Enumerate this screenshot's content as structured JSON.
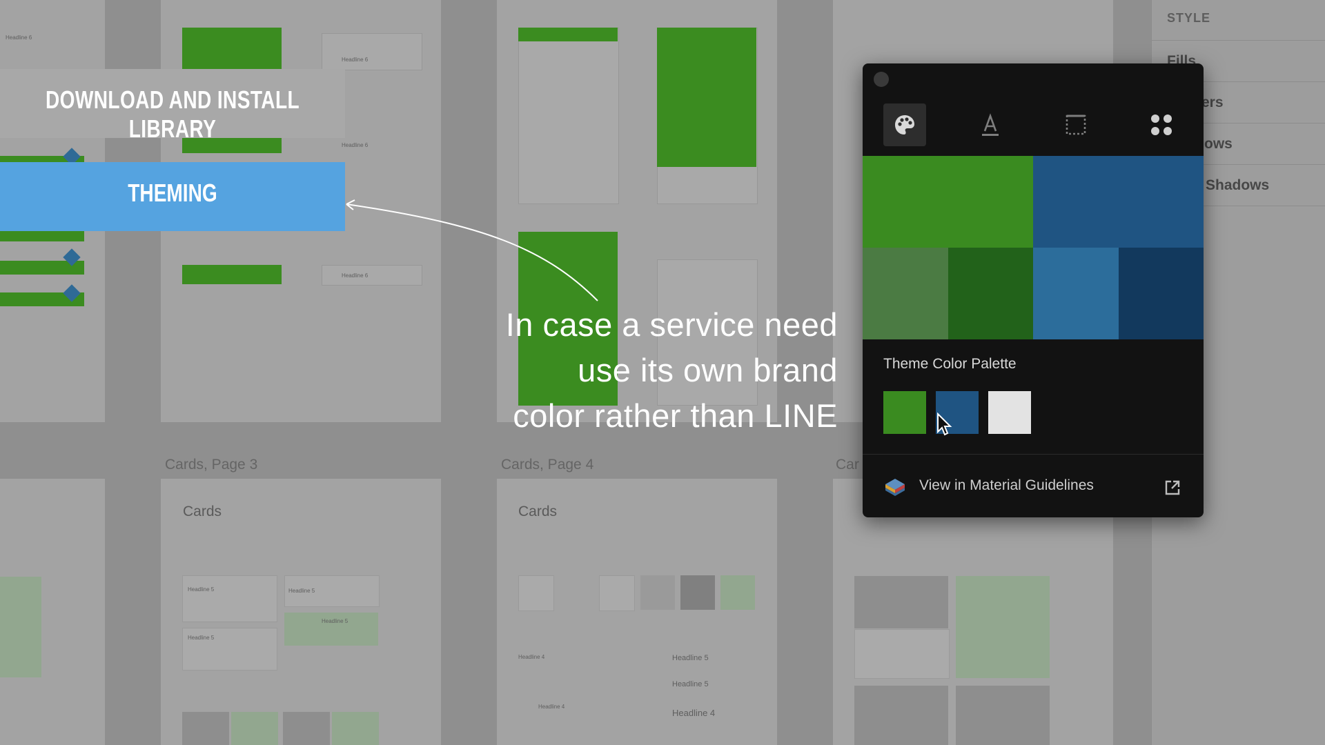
{
  "slide": {
    "download_banner": "DOWNLOAD AND INSTALL LIBRARY",
    "theming_banner": "THEMING",
    "caption_lines": [
      "In case a service need",
      "use its own brand",
      "color rather than LINE"
    ]
  },
  "background": {
    "artboard_labels": [
      "Cards, Page 3",
      "Cards, Page 4",
      "Car"
    ],
    "cards_title": "Cards",
    "headlines": [
      "Headline 5",
      "Headline 5",
      "Headline 5",
      "Headline 5",
      "Headline 4",
      "Headline 5",
      "Headline 5",
      "Headline 4",
      "Headline 4"
    ],
    "top_bar_labels": [
      "Headline 6",
      "Headline 6",
      "Headline 6",
      "Headline 6"
    ]
  },
  "style_panel": {
    "header": "STYLE",
    "rows": [
      "Fills",
      "ers",
      "ows",
      "Shadows"
    ]
  },
  "popup": {
    "tabs": [
      "palette-icon",
      "text-style-icon",
      "border-icon",
      "components-icon"
    ],
    "swatches": {
      "primary": "#3a8b20",
      "secondary": "#1f5482",
      "primary_light": "#4b7b43",
      "primary_dark": "#22621a",
      "secondary_light": "#2c6d9b",
      "secondary_dark": "#12395d"
    },
    "palette_title": "Theme Color Palette",
    "palette_chips": [
      "#3a8b20",
      "#1f5482",
      "#e3e3e3"
    ],
    "guidelines_link": "View in Material Guidelines"
  },
  "colors": {
    "theming_blue": "#55a3e0",
    "line_green": "#3b8c20"
  }
}
